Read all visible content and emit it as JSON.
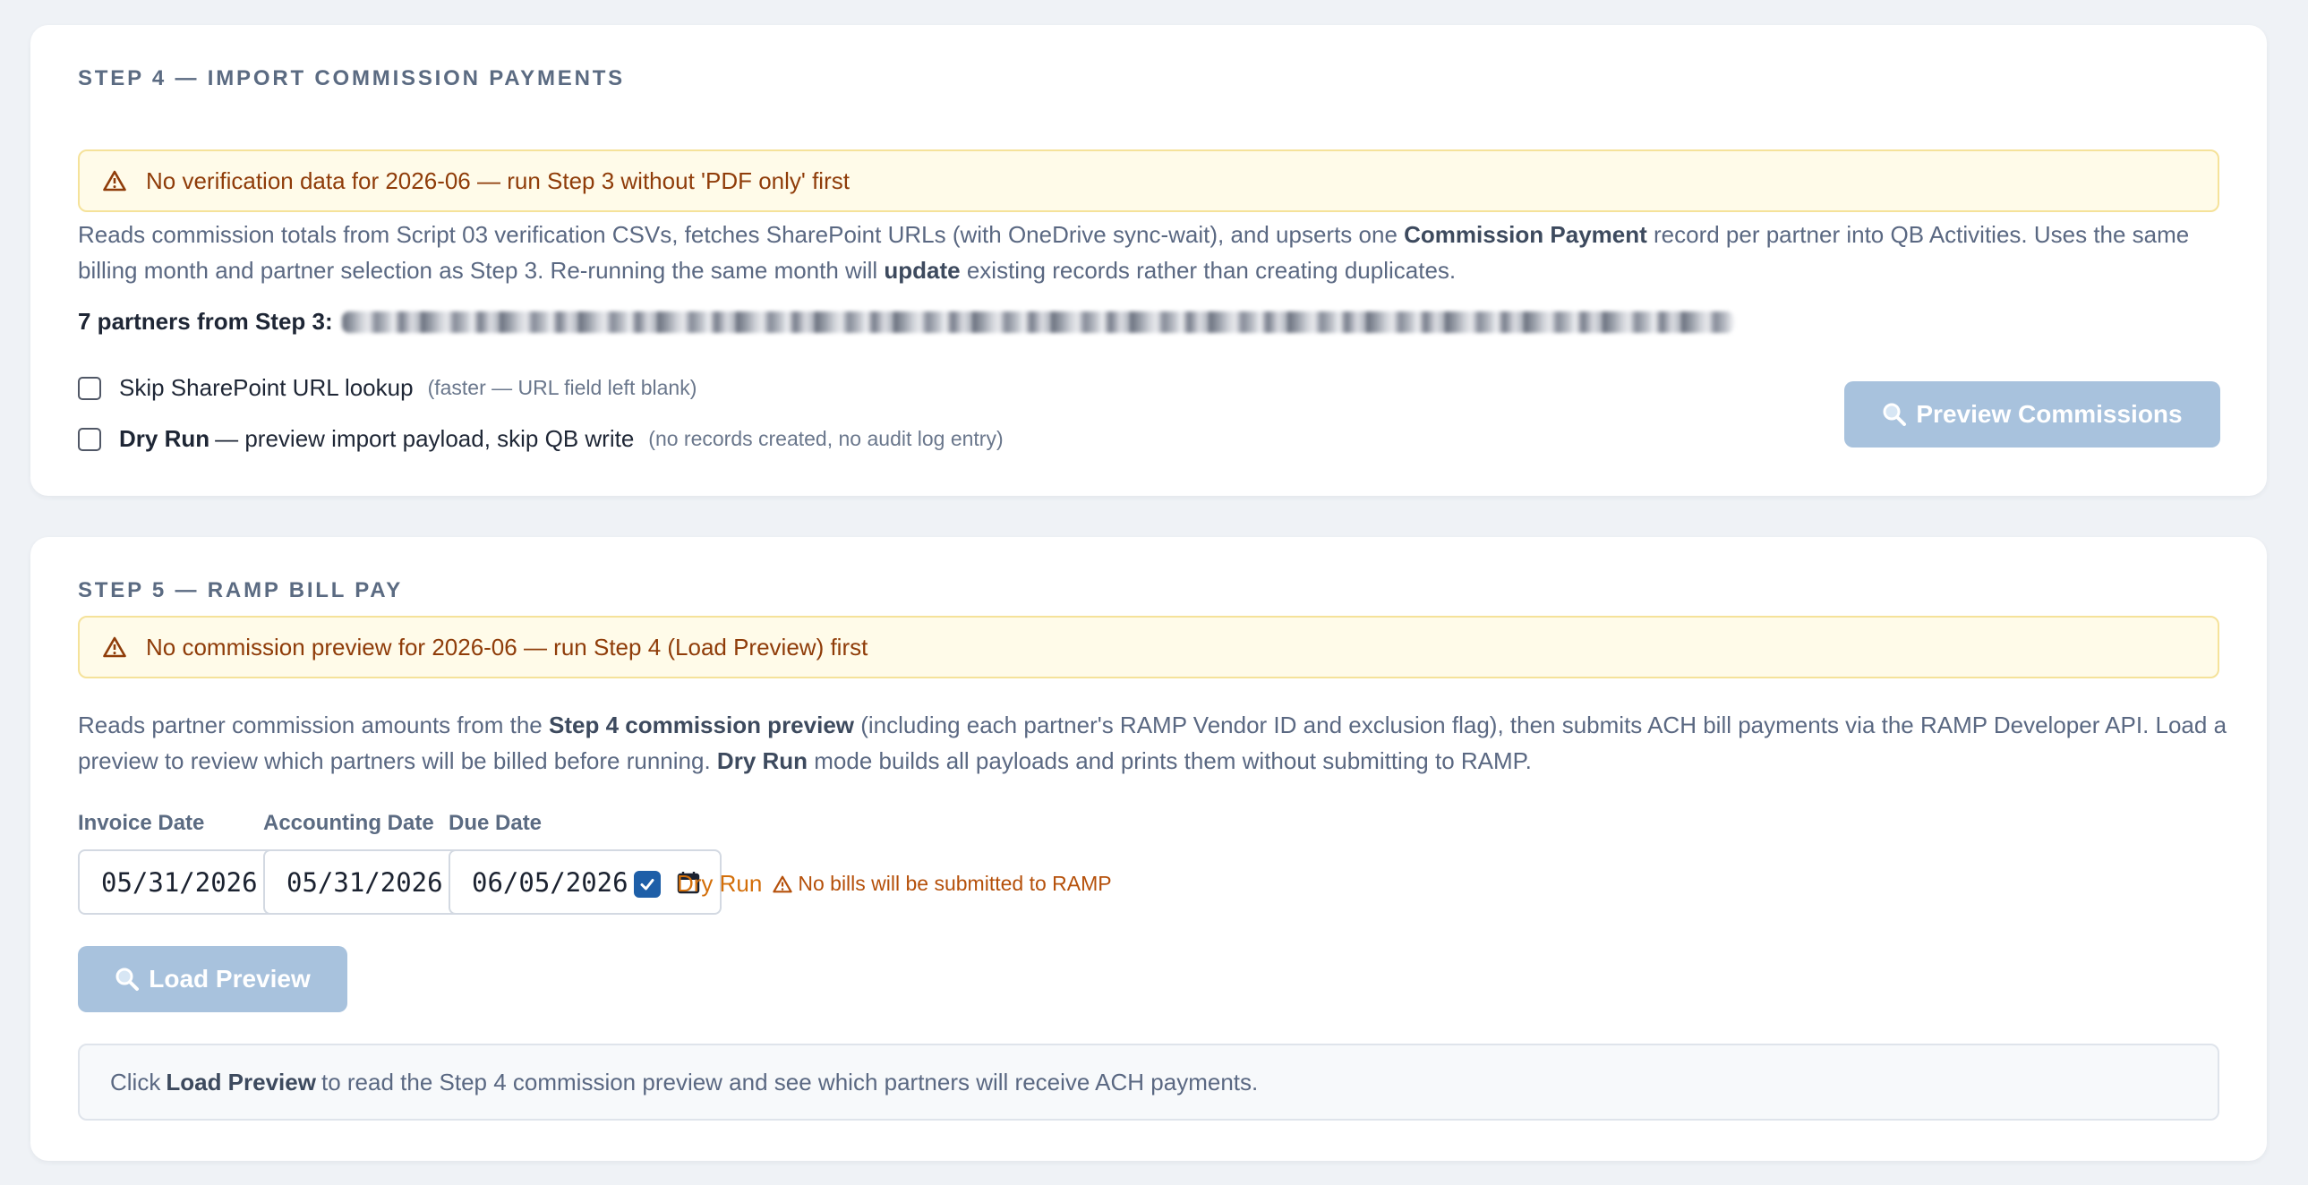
{
  "step4": {
    "title": "STEP 4 — IMPORT COMMISSION PAYMENTS",
    "warning": "No verification data for 2026-06 — run Step 3 without 'PDF only' first",
    "desc_a": "Reads commission totals from Script 03 verification CSVs, fetches SharePoint URLs (with OneDrive sync-wait), and upserts one ",
    "desc_b": "Commission Payment",
    "desc_c": " record per partner into QB Activities. Uses the same billing month and partner selection as Step 3. Re-running the same month will ",
    "desc_d": "update",
    "desc_e": " existing records rather than creating duplicates.",
    "partners_label": "7 partners from Step 3:",
    "skip_label": "Skip SharePoint URL lookup",
    "skip_hint": "(faster — URL field left blank)",
    "dry_bold": "Dry Run",
    "dry_rest": " — preview import payload, skip QB write",
    "dry_hint": "(no records created, no audit log entry)",
    "preview_button": "Preview Commissions"
  },
  "step5": {
    "title": "STEP 5 — RAMP BILL PAY",
    "warning": "No commission preview for 2026-06 — run Step 4 (Load Preview) first",
    "desc_a": "Reads partner commission amounts from the ",
    "desc_b": "Step 4 commission preview",
    "desc_c": " (including each partner's RAMP Vendor ID and exclusion flag), then submits ACH bill payments via the RAMP Developer API. Load a preview to review which partners will be billed before running. ",
    "desc_d": "Dry Run",
    "desc_e": " mode builds all payloads and prints them without submitting to RAMP.",
    "invoice_label": "Invoice Date",
    "invoice_value": "05/31/2026",
    "accounting_label": "Accounting Date",
    "accounting_value": "05/31/2026",
    "due_label": "Due Date",
    "due_value": "06/05/2026",
    "dryrun_label": "Dry Run",
    "dryrun_warning": "No bills will be submitted to RAMP",
    "load_button": "Load Preview",
    "info_a": "Click ",
    "info_b": "Load Preview",
    "info_c": " to read the Step 4 commission preview and see which partners will receive ACH payments."
  },
  "colors": {
    "warning_bg": "#fffbe9",
    "warning_text": "#8f3c09",
    "button_disabled": "#a8c2dd",
    "dryrun_orange": "#d36f0a",
    "checkbox_blue": "#1e5fa8"
  }
}
